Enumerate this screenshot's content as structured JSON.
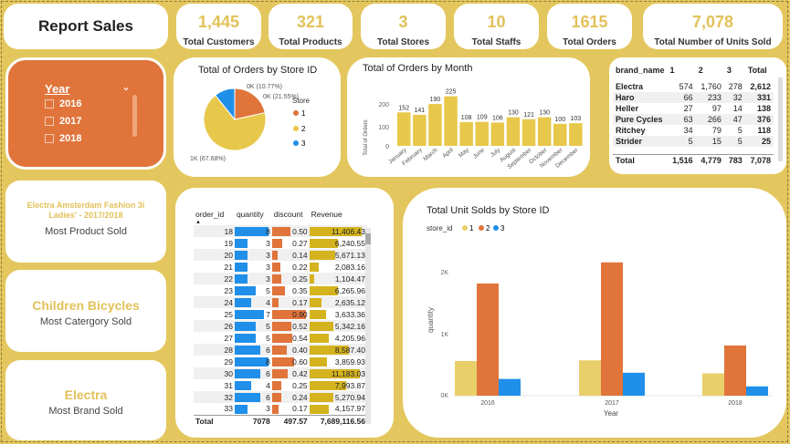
{
  "title": "Report Sales",
  "kpis": [
    {
      "value": "1,445",
      "label": "Total Customers"
    },
    {
      "value": "321",
      "label": "Total Products"
    },
    {
      "value": "3",
      "label": "Total Stores"
    },
    {
      "value": "10",
      "label": "Total Staffs"
    },
    {
      "value": "1615",
      "label": "Total Orders"
    },
    {
      "value": "7,078",
      "label": "Total Number of Units Sold"
    }
  ],
  "slicer": {
    "header": "Year",
    "items": [
      "2016",
      "2017",
      "2018"
    ]
  },
  "info": [
    {
      "big": "Electra Amsterdam Fashion 3i Ladies' - 2017/2018",
      "sub": "Most Product Sold"
    },
    {
      "big": "Children Bicycles",
      "sub": "Most Catergory Sold"
    },
    {
      "big": "Electra",
      "sub": "Most Brand Sold"
    }
  ],
  "colors": {
    "accent_yellow": "#e2c15a",
    "accent_orange": "#e0743b",
    "accent_blue": "#1f8fea",
    "bar_yellow": "#e8c84a",
    "bg": "#e3c75e"
  },
  "pie": {
    "title": "Total of Orders by Store ID",
    "legend_title": "Store",
    "labels": [
      "0K (21.55%)",
      "1K (67.68%)",
      "0K (10.77%)"
    ],
    "chart_data": {
      "type": "pie",
      "categories": [
        "1",
        "2",
        "3"
      ],
      "values": [
        21.55,
        67.68,
        10.77
      ]
    }
  },
  "month_chart": {
    "title": "Total of Orders by Month",
    "ylabel": "Total of Orders",
    "yticks": [
      "0",
      "100",
      "200"
    ],
    "chart_data": {
      "type": "bar",
      "categories": [
        "January",
        "February",
        "March",
        "April",
        "May",
        "June",
        "July",
        "August",
        "September",
        "October",
        "November",
        "December"
      ],
      "values": [
        152,
        141,
        190,
        225,
        108,
        109,
        106,
        130,
        121,
        130,
        100,
        103
      ],
      "ylim": [
        0,
        240
      ]
    }
  },
  "brand_table": {
    "headers": [
      "brand_name",
      "1",
      "2",
      "3",
      "Total"
    ],
    "rows": [
      [
        "Electra",
        "574",
        "1,760",
        "278",
        "2,612"
      ],
      [
        "Haro",
        "66",
        "233",
        "32",
        "331"
      ],
      [
        "Heller",
        "27",
        "97",
        "14",
        "138"
      ],
      [
        "Pure Cycles",
        "63",
        "266",
        "47",
        "376"
      ],
      [
        "Ritchey",
        "34",
        "79",
        "5",
        "118"
      ],
      [
        "Strider",
        "5",
        "15",
        "5",
        "25"
      ]
    ],
    "total": [
      "Total",
      "1,516",
      "4,779",
      "783",
      "7,078"
    ]
  },
  "order_table": {
    "headers": [
      "order_id",
      "quantity",
      "discount",
      "Revenue"
    ],
    "rows": [
      [
        "18",
        "8",
        "0.50",
        "11,406.43"
      ],
      [
        "19",
        "3",
        "0.27",
        "6,240.55"
      ],
      [
        "20",
        "3",
        "0.14",
        "5,671.13"
      ],
      [
        "21",
        "3",
        "0.22",
        "2,083.16"
      ],
      [
        "22",
        "3",
        "0.25",
        "1,104.47"
      ],
      [
        "23",
        "5",
        "0.35",
        "6,265.96"
      ],
      [
        "24",
        "4",
        "0.17",
        "2,635.12"
      ],
      [
        "25",
        "7",
        "0.90",
        "3,633.36"
      ],
      [
        "26",
        "5",
        "0.52",
        "5,342.16"
      ],
      [
        "27",
        "5",
        "0.54",
        "4,205.96"
      ],
      [
        "28",
        "6",
        "0.40",
        "8,587.40"
      ],
      [
        "29",
        "8",
        "0.60",
        "3,859.93"
      ],
      [
        "30",
        "6",
        "0.42",
        "11,183.03"
      ],
      [
        "31",
        "4",
        "0.25",
        "7,993.87"
      ],
      [
        "32",
        "6",
        "0.24",
        "5,270.94"
      ],
      [
        "33",
        "3",
        "0.17",
        "4,157.97"
      ]
    ],
    "total": [
      "Total",
      "7078",
      "497.57",
      "7,689,116.56"
    ]
  },
  "unit_chart": {
    "title": "Total Unit Solds by Store ID",
    "legend_title": "store_id",
    "ylabel": "quantity",
    "xlabel": "Year",
    "yticks": [
      "0K",
      "1K",
      "2K"
    ],
    "chart_data": {
      "type": "bar",
      "categories": [
        "2016",
        "2017",
        "2018"
      ],
      "series": [
        {
          "name": "1",
          "values": [
            560,
            570,
            360
          ]
        },
        {
          "name": "2",
          "values": [
            1810,
            2150,
            810
          ]
        },
        {
          "name": "3",
          "values": [
            270,
            370,
            150
          ]
        }
      ],
      "ylim": [
        0,
        2300
      ]
    }
  }
}
